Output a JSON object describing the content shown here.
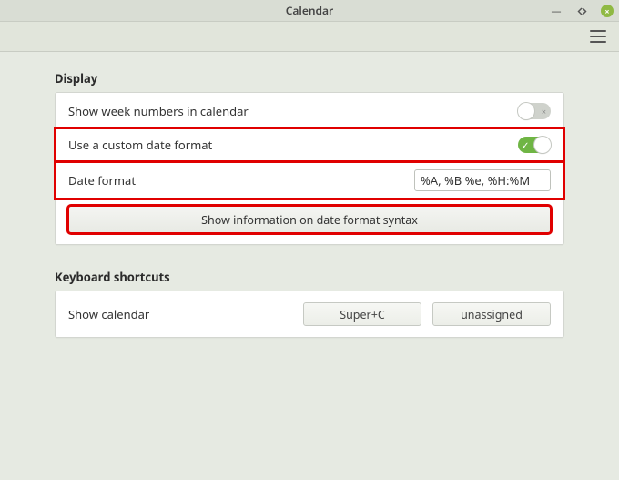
{
  "window": {
    "title": "Calendar"
  },
  "sections": {
    "display": {
      "title": "Display",
      "show_week_numbers_label": "Show week numbers in calendar",
      "show_week_numbers_on": false,
      "use_custom_format_label": "Use a custom date format",
      "use_custom_format_on": true,
      "date_format_label": "Date format",
      "date_format_value": "%A, %B %e, %H:%M",
      "syntax_button_label": "Show information on date format syntax"
    },
    "shortcuts": {
      "title": "Keyboard shortcuts",
      "show_calendar_label": "Show calendar",
      "show_calendar_binding1": "Super+C",
      "show_calendar_binding2": "unassigned"
    }
  }
}
